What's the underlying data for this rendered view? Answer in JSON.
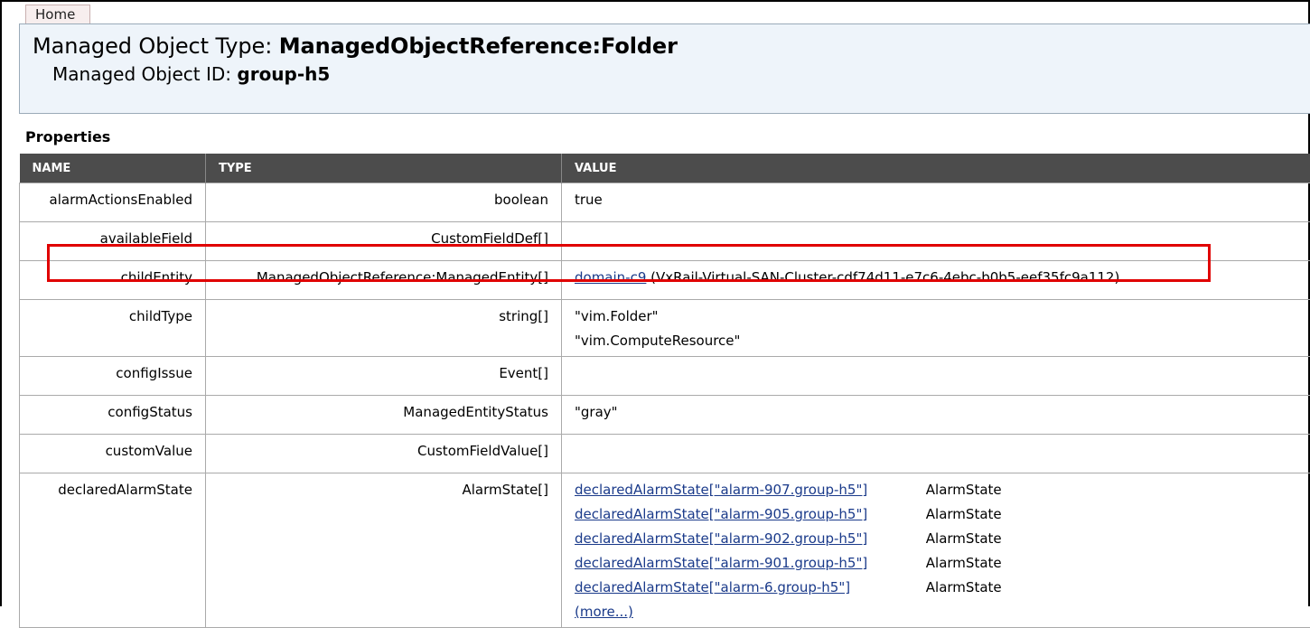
{
  "tab": {
    "home_label": "Home"
  },
  "header": {
    "type_label": "Managed Object Type:",
    "type_value": "ManagedObjectReference:Folder",
    "id_label": "Managed Object ID:",
    "id_value": "group-h5"
  },
  "properties": {
    "title": "Properties",
    "columns": [
      "NAME",
      "TYPE",
      "VALUE"
    ],
    "rows": {
      "alarmActionsEnabled": {
        "name": "alarmActionsEnabled",
        "type": "boolean",
        "value": "true"
      },
      "availableField": {
        "name": "availableField",
        "type": "CustomFieldDef[]",
        "value": ""
      },
      "childEntity": {
        "name": "childEntity",
        "type": "ManagedObjectReference:ManagedEntity[]",
        "value_link": "domain-c9",
        "value_extra": "(VxRail-Virtual-SAN-Cluster-cdf74d11-e7c6-4ebc-b0b5-eef35fc9a112)"
      },
      "childType": {
        "name": "childType",
        "type": "string[]",
        "values": [
          "\"vim.Folder\"",
          "\"vim.ComputeResource\""
        ]
      },
      "configIssue": {
        "name": "configIssue",
        "type": "Event[]",
        "value": ""
      },
      "configStatus": {
        "name": "configStatus",
        "type": "ManagedEntityStatus",
        "value": "\"gray\""
      },
      "customValue": {
        "name": "customValue",
        "type": "CustomFieldValue[]",
        "value": ""
      },
      "declaredAlarmState": {
        "name": "declaredAlarmState",
        "type": "AlarmState[]",
        "items": [
          {
            "link": "declaredAlarmState[\"alarm-907.group-h5\"]",
            "type": "AlarmState"
          },
          {
            "link": "declaredAlarmState[\"alarm-905.group-h5\"]",
            "type": "AlarmState"
          },
          {
            "link": "declaredAlarmState[\"alarm-902.group-h5\"]",
            "type": "AlarmState"
          },
          {
            "link": "declaredAlarmState[\"alarm-901.group-h5\"]",
            "type": "AlarmState"
          },
          {
            "link": "declaredAlarmState[\"alarm-6.group-h5\"]",
            "type": "AlarmState"
          }
        ],
        "more_label": "(more...)"
      }
    }
  },
  "colors": {
    "header_bg": "#eef4fa",
    "table_header_bg": "#4c4c4c",
    "link": "#1a3a8a",
    "highlight": "#e00000"
  }
}
